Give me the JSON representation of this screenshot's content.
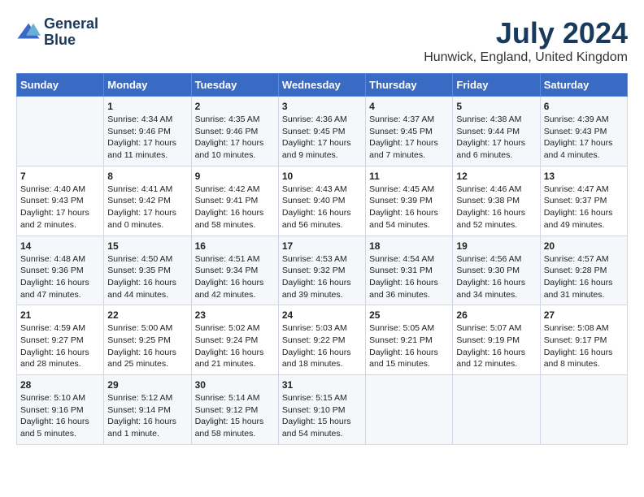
{
  "header": {
    "logo_line1": "General",
    "logo_line2": "Blue",
    "main_title": "July 2024",
    "subtitle": "Hunwick, England, United Kingdom"
  },
  "columns": [
    "Sunday",
    "Monday",
    "Tuesday",
    "Wednesday",
    "Thursday",
    "Friday",
    "Saturday"
  ],
  "rows": [
    [
      {
        "day": "",
        "info": ""
      },
      {
        "day": "1",
        "info": "Sunrise: 4:34 AM\nSunset: 9:46 PM\nDaylight: 17 hours\nand 11 minutes."
      },
      {
        "day": "2",
        "info": "Sunrise: 4:35 AM\nSunset: 9:46 PM\nDaylight: 17 hours\nand 10 minutes."
      },
      {
        "day": "3",
        "info": "Sunrise: 4:36 AM\nSunset: 9:45 PM\nDaylight: 17 hours\nand 9 minutes."
      },
      {
        "day": "4",
        "info": "Sunrise: 4:37 AM\nSunset: 9:45 PM\nDaylight: 17 hours\nand 7 minutes."
      },
      {
        "day": "5",
        "info": "Sunrise: 4:38 AM\nSunset: 9:44 PM\nDaylight: 17 hours\nand 6 minutes."
      },
      {
        "day": "6",
        "info": "Sunrise: 4:39 AM\nSunset: 9:43 PM\nDaylight: 17 hours\nand 4 minutes."
      }
    ],
    [
      {
        "day": "7",
        "info": "Sunrise: 4:40 AM\nSunset: 9:43 PM\nDaylight: 17 hours\nand 2 minutes."
      },
      {
        "day": "8",
        "info": "Sunrise: 4:41 AM\nSunset: 9:42 PM\nDaylight: 17 hours\nand 0 minutes."
      },
      {
        "day": "9",
        "info": "Sunrise: 4:42 AM\nSunset: 9:41 PM\nDaylight: 16 hours\nand 58 minutes."
      },
      {
        "day": "10",
        "info": "Sunrise: 4:43 AM\nSunset: 9:40 PM\nDaylight: 16 hours\nand 56 minutes."
      },
      {
        "day": "11",
        "info": "Sunrise: 4:45 AM\nSunset: 9:39 PM\nDaylight: 16 hours\nand 54 minutes."
      },
      {
        "day": "12",
        "info": "Sunrise: 4:46 AM\nSunset: 9:38 PM\nDaylight: 16 hours\nand 52 minutes."
      },
      {
        "day": "13",
        "info": "Sunrise: 4:47 AM\nSunset: 9:37 PM\nDaylight: 16 hours\nand 49 minutes."
      }
    ],
    [
      {
        "day": "14",
        "info": "Sunrise: 4:48 AM\nSunset: 9:36 PM\nDaylight: 16 hours\nand 47 minutes."
      },
      {
        "day": "15",
        "info": "Sunrise: 4:50 AM\nSunset: 9:35 PM\nDaylight: 16 hours\nand 44 minutes."
      },
      {
        "day": "16",
        "info": "Sunrise: 4:51 AM\nSunset: 9:34 PM\nDaylight: 16 hours\nand 42 minutes."
      },
      {
        "day": "17",
        "info": "Sunrise: 4:53 AM\nSunset: 9:32 PM\nDaylight: 16 hours\nand 39 minutes."
      },
      {
        "day": "18",
        "info": "Sunrise: 4:54 AM\nSunset: 9:31 PM\nDaylight: 16 hours\nand 36 minutes."
      },
      {
        "day": "19",
        "info": "Sunrise: 4:56 AM\nSunset: 9:30 PM\nDaylight: 16 hours\nand 34 minutes."
      },
      {
        "day": "20",
        "info": "Sunrise: 4:57 AM\nSunset: 9:28 PM\nDaylight: 16 hours\nand 31 minutes."
      }
    ],
    [
      {
        "day": "21",
        "info": "Sunrise: 4:59 AM\nSunset: 9:27 PM\nDaylight: 16 hours\nand 28 minutes."
      },
      {
        "day": "22",
        "info": "Sunrise: 5:00 AM\nSunset: 9:25 PM\nDaylight: 16 hours\nand 25 minutes."
      },
      {
        "day": "23",
        "info": "Sunrise: 5:02 AM\nSunset: 9:24 PM\nDaylight: 16 hours\nand 21 minutes."
      },
      {
        "day": "24",
        "info": "Sunrise: 5:03 AM\nSunset: 9:22 PM\nDaylight: 16 hours\nand 18 minutes."
      },
      {
        "day": "25",
        "info": "Sunrise: 5:05 AM\nSunset: 9:21 PM\nDaylight: 16 hours\nand 15 minutes."
      },
      {
        "day": "26",
        "info": "Sunrise: 5:07 AM\nSunset: 9:19 PM\nDaylight: 16 hours\nand 12 minutes."
      },
      {
        "day": "27",
        "info": "Sunrise: 5:08 AM\nSunset: 9:17 PM\nDaylight: 16 hours\nand 8 minutes."
      }
    ],
    [
      {
        "day": "28",
        "info": "Sunrise: 5:10 AM\nSunset: 9:16 PM\nDaylight: 16 hours\nand 5 minutes."
      },
      {
        "day": "29",
        "info": "Sunrise: 5:12 AM\nSunset: 9:14 PM\nDaylight: 16 hours\nand 1 minute."
      },
      {
        "day": "30",
        "info": "Sunrise: 5:14 AM\nSunset: 9:12 PM\nDaylight: 15 hours\nand 58 minutes."
      },
      {
        "day": "31",
        "info": "Sunrise: 5:15 AM\nSunset: 9:10 PM\nDaylight: 15 hours\nand 54 minutes."
      },
      {
        "day": "",
        "info": ""
      },
      {
        "day": "",
        "info": ""
      },
      {
        "day": "",
        "info": ""
      }
    ]
  ]
}
